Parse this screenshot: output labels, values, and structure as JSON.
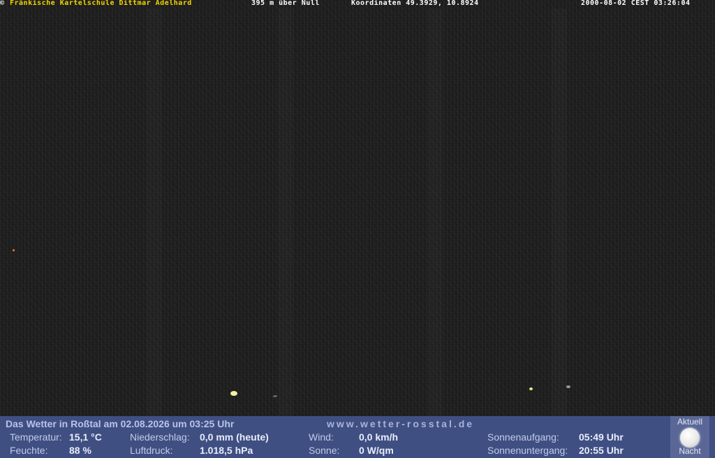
{
  "overlay": {
    "copyright_symbol": "©",
    "owner": "Fränkische Kartelschule Dittmar Adelhard",
    "altitude": "395 m über Null",
    "coordinates": "Koordinaten 49.3929, 10.8924",
    "timestamp": "2000-08-02 CEST 03:26:04"
  },
  "weather": {
    "title": "Das Wetter in Roßtal am 02.08.2026 um 03:25 Uhr",
    "website": "www.wetter-rosstal.de",
    "temperature": {
      "label": "Temperatur:",
      "value": "15,1 °C"
    },
    "humidity": {
      "label": "Feuchte:",
      "value": "88 %"
    },
    "precipitation": {
      "label": "Niederschlag:",
      "value": "0,0 mm (heute)"
    },
    "pressure": {
      "label": "Luftdruck:",
      "value": "1.018,5 hPa"
    },
    "wind": {
      "label": "Wind:",
      "value": "0,0 km/h"
    },
    "sun": {
      "label": "Sonne:",
      "value": "0 W/qm"
    },
    "sunrise": {
      "label": "Sonnenaufgang:",
      "value": "05:49 Uhr"
    },
    "sunset": {
      "label": "Sonnenuntergang:",
      "value": "20:55 Uhr"
    },
    "moon": {
      "top_label": "Aktuell",
      "bottom_label": "Nacht",
      "icon": "full-moon-icon"
    }
  },
  "colors": {
    "overlay_yellow": "#f2d600",
    "bar_background": "#3f4f82"
  }
}
